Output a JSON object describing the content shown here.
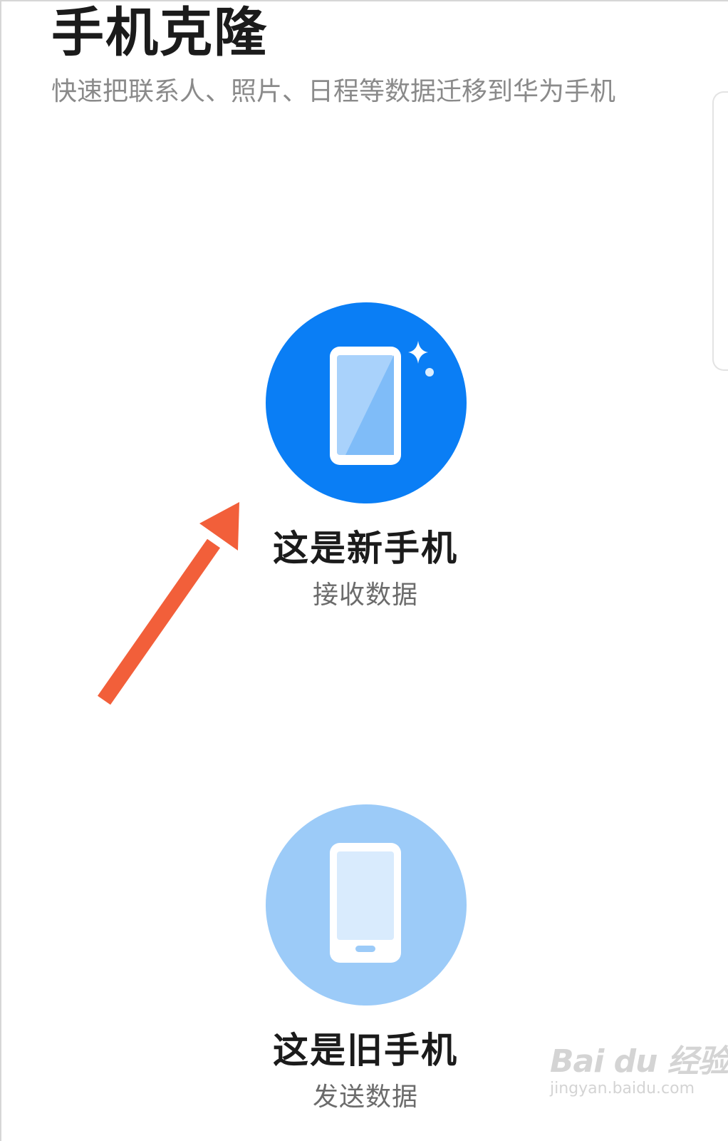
{
  "header": {
    "title": "手机克隆",
    "subtitle": "快速把联系人、照片、日程等数据迁移到华为手机"
  },
  "options": {
    "new_phone": {
      "label": "这是新手机",
      "sublabel": "接收数据",
      "icon": "new-phone-icon",
      "circle_color": "#0a7ef5"
    },
    "old_phone": {
      "label": "这是旧手机",
      "sublabel": "发送数据",
      "icon": "old-phone-icon",
      "circle_color": "#9ccbf8"
    }
  },
  "annotation": {
    "arrow_color": "#f25f3a"
  },
  "watermark": {
    "logo": "Bai du 经验",
    "url": "jingyan.baidu.com"
  }
}
